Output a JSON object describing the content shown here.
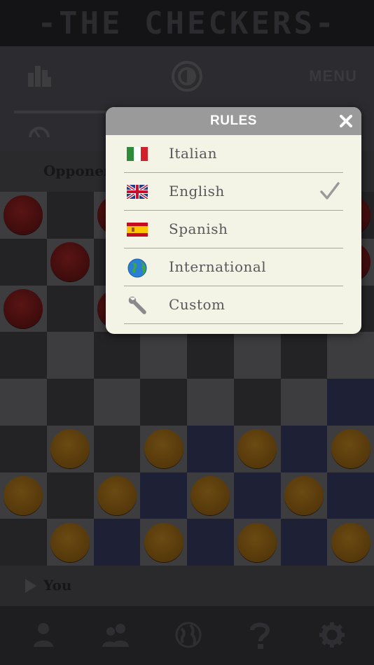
{
  "app": {
    "title": "-THE CHECKERS-"
  },
  "toolbar": {
    "menu_label": "MENU",
    "icons": [
      "leaderboard-icon",
      "theme-toggle-icon",
      "speedometer-icon"
    ]
  },
  "players": {
    "opponent_label": "Opponent",
    "you_label": "You"
  },
  "board": {
    "size": 8,
    "red_positions": [
      [
        0,
        0
      ],
      [
        0,
        2
      ],
      [
        0,
        7
      ],
      [
        1,
        1
      ],
      [
        1,
        7
      ],
      [
        2,
        0
      ],
      [
        2,
        2
      ]
    ],
    "gold_positions": [
      [
        5,
        1
      ],
      [
        5,
        3
      ],
      [
        5,
        5
      ],
      [
        5,
        7
      ],
      [
        6,
        0
      ],
      [
        6,
        2
      ],
      [
        6,
        4
      ],
      [
        6,
        6
      ],
      [
        7,
        1
      ],
      [
        7,
        3
      ],
      [
        7,
        5
      ],
      [
        7,
        7
      ]
    ]
  },
  "modal": {
    "title": "RULES",
    "items": [
      {
        "label": "Italian",
        "icon": "italy-flag-icon",
        "selected": false
      },
      {
        "label": "English",
        "icon": "uk-flag-icon",
        "selected": true
      },
      {
        "label": "Spanish",
        "icon": "spain-flag-icon",
        "selected": false
      },
      {
        "label": "International",
        "icon": "globe-icon",
        "selected": false
      },
      {
        "label": "Custom",
        "icon": "wrench-icon",
        "selected": false
      }
    ]
  },
  "bottom_bar": {
    "icons": [
      "profile-icon",
      "two-players-icon",
      "online-globe-icon",
      "help-icon",
      "settings-gear-icon"
    ]
  },
  "colors": {
    "modal_bg": "#f3f3e6",
    "header_bg": "#9a9a9a",
    "red_piece": "#3e0c0c",
    "gold_piece": "#55380b"
  }
}
